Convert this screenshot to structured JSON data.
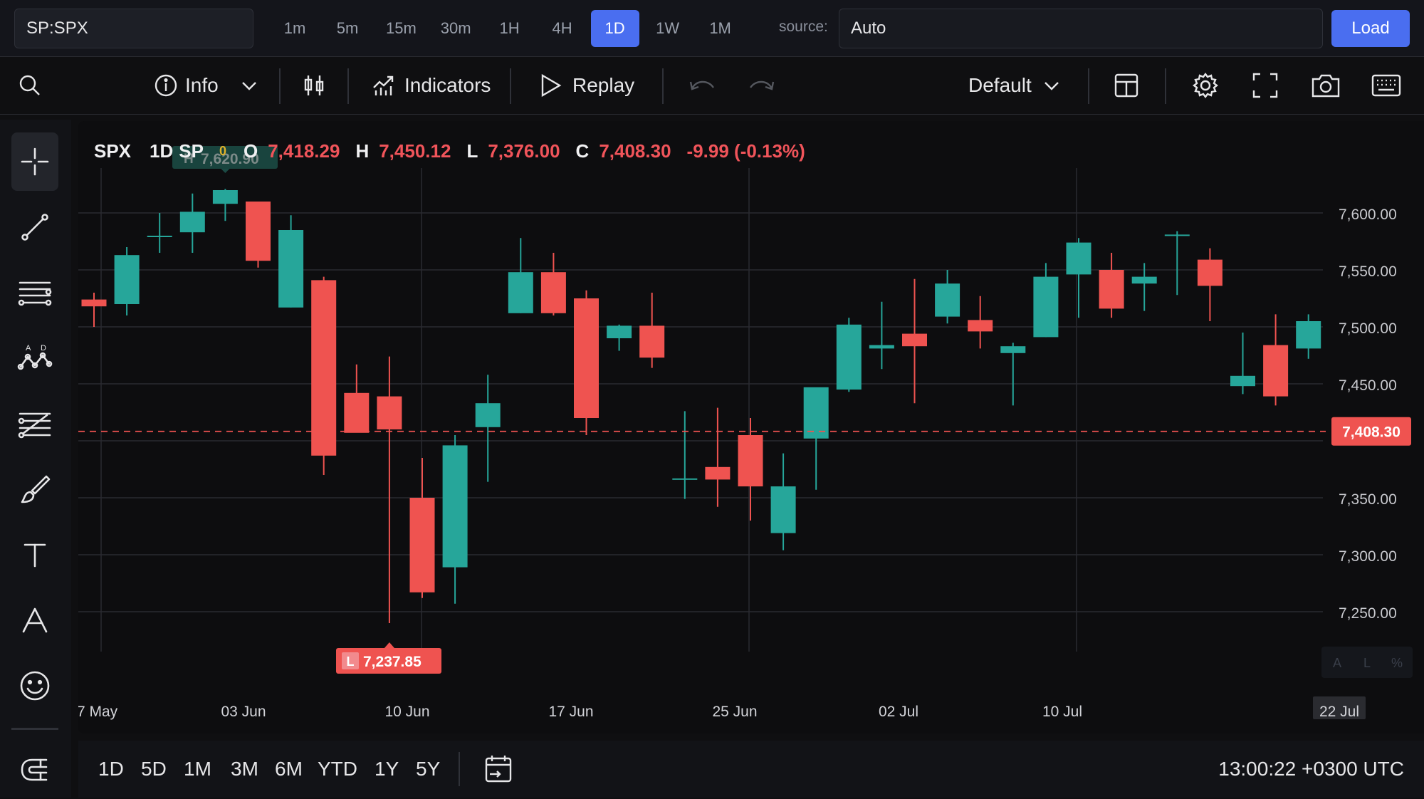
{
  "topbar": {
    "symbol": "SP:SPX",
    "intervals": [
      "1m",
      "5m",
      "15m",
      "30m",
      "1H",
      "4H",
      "1D",
      "1W",
      "1M"
    ],
    "active_interval": "1D",
    "source_label": "source:",
    "source_value": "Auto",
    "load_label": "Load"
  },
  "toolbar": {
    "info_label": "Info",
    "indicators_label": "Indicators",
    "replay_label": "Replay",
    "layout_label": "Default"
  },
  "legend": {
    "symbol": "SPX",
    "timeframe": "1D",
    "source": "SP",
    "status": "0",
    "o_key": "O",
    "o_val": "7,418.29",
    "h_key": "H",
    "h_val": "7,450.12",
    "l_key": "L",
    "l_val": "7,376.00",
    "c_key": "C",
    "c_val": "7,408.30",
    "change": "-9.99 (-0.13%)"
  },
  "colors": {
    "up": "#26a69a",
    "down": "#ef5350",
    "accent": "#4a6ef0"
  },
  "bottom": {
    "ranges": [
      "1D",
      "5D",
      "1M",
      "3M",
      "6M",
      "YTD",
      "1Y",
      "5Y"
    ],
    "clock": "13:00:22 +0300 UTC"
  },
  "chart_data": {
    "type": "candlestick",
    "y_ticks": [
      "7,600.00",
      "7,550.00",
      "7,500.00",
      "7,450.00",
      "7,350.00",
      "7,300.00",
      "7,250.00"
    ],
    "y_tick_values": [
      7600,
      7550,
      7500,
      7450,
      7350,
      7300,
      7250
    ],
    "x_ticks": [
      "7 May",
      "03 Jun",
      "10 Jun",
      "17 Jun",
      "25 Jun",
      "02 Jul",
      "10 Jul",
      "22 Jul"
    ],
    "ylim": [
      7230,
      7630
    ],
    "last_price": 7408.3,
    "last_price_label": "7,408.30",
    "high_marker": {
      "key": "H",
      "value": 7620.9,
      "label": "7,620.90"
    },
    "low_marker": {
      "key": "L",
      "value": 7237.85,
      "label": "7,237.85"
    },
    "scale_buttons": [
      "A",
      "L",
      "%"
    ],
    "candles": [
      {
        "o": 7524,
        "h": 7530,
        "l": 7500,
        "c": 7518
      },
      {
        "o": 7520,
        "h": 7570,
        "l": 7510,
        "c": 7563
      },
      {
        "o": 7580,
        "h": 7600,
        "l": 7565,
        "c": 7580
      },
      {
        "o": 7583,
        "h": 7617,
        "l": 7565,
        "c": 7601
      },
      {
        "o": 7608,
        "h": 7621,
        "l": 7593,
        "c": 7620
      },
      {
        "o": 7610,
        "h": 7610,
        "l": 7552,
        "c": 7558
      },
      {
        "o": 7517,
        "h": 7598,
        "l": 7517,
        "c": 7585
      },
      {
        "o": 7541,
        "h": 7544,
        "l": 7370,
        "c": 7387
      },
      {
        "o": 7442,
        "h": 7467,
        "l": 7410,
        "c": 7407
      },
      {
        "o": 7439,
        "h": 7474,
        "l": 7240,
        "c": 7410
      },
      {
        "o": 7350,
        "h": 7385,
        "l": 7262,
        "c": 7267
      },
      {
        "o": 7289,
        "h": 7405,
        "l": 7257,
        "c": 7396
      },
      {
        "o": 7412,
        "h": 7458,
        "l": 7364,
        "c": 7433
      },
      {
        "o": 7512,
        "h": 7578,
        "l": 7512,
        "c": 7548
      },
      {
        "o": 7548,
        "h": 7565,
        "l": 7510,
        "c": 7512
      },
      {
        "o": 7525,
        "h": 7532,
        "l": 7405,
        "c": 7420
      },
      {
        "o": 7490,
        "h": 7502,
        "l": 7479,
        "c": 7501
      },
      {
        "o": 7501,
        "h": 7530,
        "l": 7464,
        "c": 7473
      },
      {
        "o": 7367,
        "h": 7426,
        "l": 7349,
        "c": 7367
      },
      {
        "o": 7377,
        "h": 7429,
        "l": 7342,
        "c": 7366
      },
      {
        "o": 7405,
        "h": 7420,
        "l": 7330,
        "c": 7360
      },
      {
        "o": 7319,
        "h": 7389,
        "l": 7304,
        "c": 7360
      },
      {
        "o": 7402,
        "h": 7444,
        "l": 7357,
        "c": 7447
      },
      {
        "o": 7445,
        "h": 7508,
        "l": 7443,
        "c": 7502
      },
      {
        "o": 7481,
        "h": 7522,
        "l": 7463,
        "c": 7484
      },
      {
        "o": 7494,
        "h": 7542,
        "l": 7433,
        "c": 7483
      },
      {
        "o": 7509,
        "h": 7550,
        "l": 7503,
        "c": 7538
      },
      {
        "o": 7506,
        "h": 7527,
        "l": 7481,
        "c": 7496
      },
      {
        "o": 7477,
        "h": 7486,
        "l": 7431,
        "c": 7483
      },
      {
        "o": 7491,
        "h": 7556,
        "l": 7491,
        "c": 7544
      },
      {
        "o": 7546,
        "h": 7578,
        "l": 7508,
        "c": 7574
      },
      {
        "o": 7550,
        "h": 7565,
        "l": 7508,
        "c": 7516
      },
      {
        "o": 7538,
        "h": 7556,
        "l": 7514,
        "c": 7544
      },
      {
        "o": 7581,
        "h": 7584,
        "l": 7528,
        "c": 7581
      },
      {
        "o": 7559,
        "h": 7569,
        "l": 7505,
        "c": 7536
      },
      {
        "o": 7448,
        "h": 7495,
        "l": 7441,
        "c": 7457
      },
      {
        "o": 7484,
        "h": 7511,
        "l": 7431,
        "c": 7439
      },
      {
        "o": 7481,
        "h": 7511,
        "l": 7472,
        "c": 7505
      }
    ]
  }
}
